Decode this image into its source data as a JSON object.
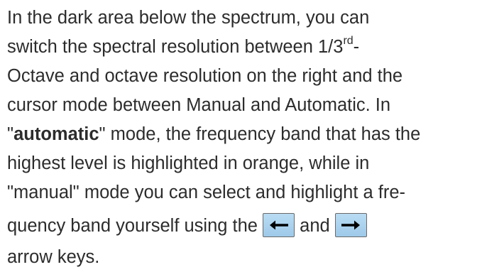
{
  "paragraph": {
    "line1": "In the dark area below the spectrum, you can",
    "line2_a": "switch the spectral resolution between 1/3",
    "line2_sup": "rd",
    "line2_b": "-",
    "line3": "Octave and octave resolution on the right and the",
    "line4": "cursor mode between Manual and Automatic. In",
    "line5_a": "\"",
    "line5_bold": "automatic",
    "line5_b": "\" mode, the frequency band that has the",
    "line6": "highest level is highlighted in orange, while in",
    "line7": "\"manual\" mode you can select and highlight a fre-",
    "line8_a": "quency band yourself using the ",
    "line8_b": " and ",
    "line9": "arrow keys."
  },
  "keys": {
    "left": "left-arrow-key",
    "right": "right-arrow-key"
  },
  "colors": {
    "text": "#2c2c2c",
    "key_fill_top": "#b9dcf3",
    "key_fill_bottom": "#9ec9e9",
    "key_border": "#6a6a6a",
    "arrow": "#000000"
  }
}
